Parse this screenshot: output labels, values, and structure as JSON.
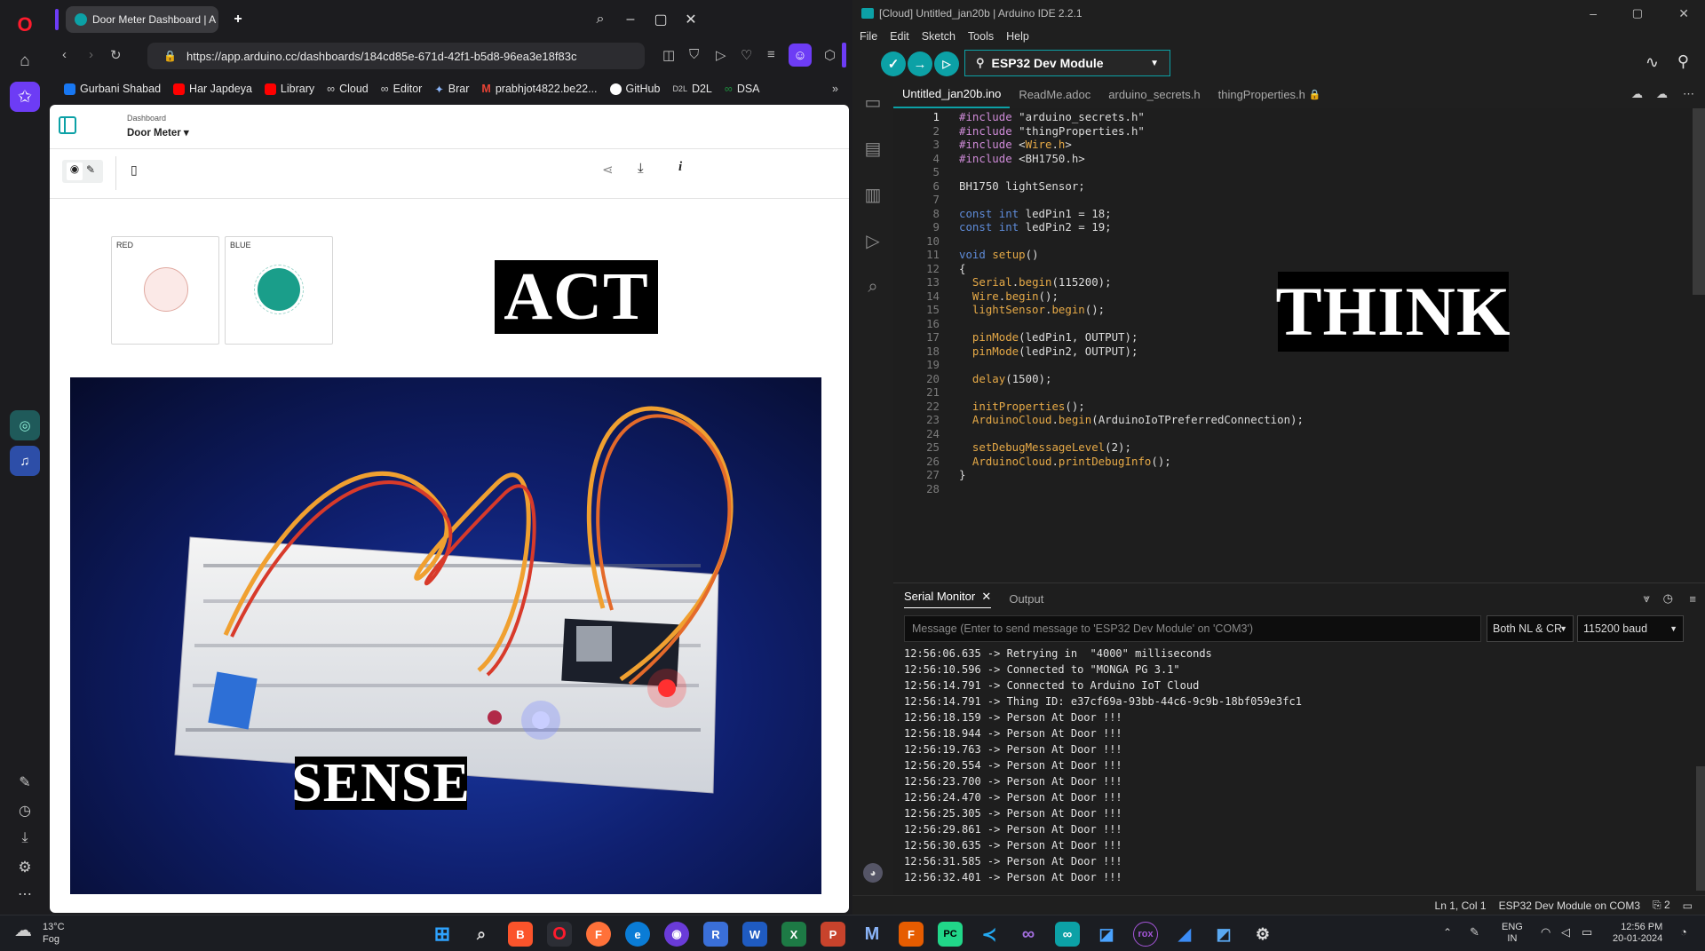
{
  "browser": {
    "tab_title": "Door Meter Dashboard | A",
    "url": "https://app.arduino.cc/dashboards/184cd85e-671d-42f1-b5d8-96ea3e18f83c",
    "bookmarks": [
      "Gurbani Shabad",
      "Har Japdeya",
      "Library",
      "Cloud",
      "Editor",
      "Brar",
      "prabhjot4822.be22...",
      "GitHub",
      "D2L",
      "DSA"
    ],
    "bookmark_colors": [
      "#1877f2",
      "#ff0000",
      "#ff0000",
      "#cccccc",
      "#cccccc",
      "#8ab4f8",
      "#ea4335",
      "#ffffff",
      "#cccccc",
      "#1e8e3e"
    ]
  },
  "dashboard": {
    "breadcrumb": "Dashboard",
    "name": "Door Meter",
    "widgets": [
      {
        "label": "RED",
        "state": "off",
        "color": "#fbe9e7"
      },
      {
        "label": "BLUE",
        "state": "on",
        "color": "#1a9e8a"
      }
    ]
  },
  "overlays": {
    "act": "ACT",
    "think": "THINK",
    "sense": "SENSE"
  },
  "ide": {
    "title": "[Cloud] Untitled_jan20b | Arduino IDE 2.2.1",
    "menu": [
      "File",
      "Edit",
      "Sketch",
      "Tools",
      "Help"
    ],
    "board": "ESP32 Dev Module",
    "file_tabs": [
      "Untitled_jan20b.ino",
      "ReadMe.adoc",
      "arduino_secrets.h",
      "thingProperties.h"
    ],
    "code_lines": [
      "#include \"arduino_secrets.h\"",
      "#include \"thingProperties.h\"",
      "#include <Wire.h>",
      "#include <BH1750.h>",
      "",
      "BH1750 lightSensor;",
      "",
      "const int ledPin1 = 18;",
      "const int ledPin2 = 19;",
      "",
      "void setup()",
      "{",
      "  Serial.begin(115200);",
      "  Wire.begin();",
      "  lightSensor.begin();",
      "",
      "  pinMode(ledPin1, OUTPUT);",
      "  pinMode(ledPin2, OUTPUT);",
      "",
      "  delay(1500);",
      "",
      "  initProperties();",
      "  ArduinoCloud.begin(ArduinoIoTPreferredConnection);",
      "",
      "  setDebugMessageLevel(2);",
      "  ArduinoCloud.printDebugInfo();",
      "}",
      ""
    ],
    "serial_tab": "Serial Monitor",
    "output_tab": "Output",
    "message_placeholder": "Message (Enter to send message to 'ESP32 Dev Module' on 'COM3')",
    "line_ending": "Both NL & CR",
    "baud": "115200 baud",
    "serial_log": [
      "12:56:06.635 -> Retrying in  \"4000\" milliseconds",
      "12:56:10.596 -> Connected to \"MONGA PG 3.1\"",
      "12:56:14.791 -> Connected to Arduino IoT Cloud",
      "12:56:14.791 -> Thing ID: e37cf69a-93bb-44c6-9c9b-18bf059e3fc1",
      "12:56:18.159 -> Person At Door !!!",
      "12:56:18.944 -> Person At Door !!!",
      "12:56:19.763 -> Person At Door !!!",
      "12:56:20.554 -> Person At Door !!!",
      "12:56:23.700 -> Person At Door !!!",
      "12:56:24.470 -> Person At Door !!!",
      "12:56:25.305 -> Person At Door !!!",
      "12:56:29.861 -> Person At Door !!!",
      "12:56:30.635 -> Person At Door !!!",
      "12:56:31.585 -> Person At Door !!!",
      "12:56:32.401 -> Person At Door !!!"
    ],
    "status_position": "Ln 1, Col 1",
    "status_board": "ESP32 Dev Module on COM3",
    "status_notifications": "2"
  },
  "taskbar": {
    "weather_temp": "13°C",
    "weather_desc": "Fog",
    "lang": "ENG",
    "region": "IN",
    "time": "12:56 PM",
    "date": "20-01-2024"
  }
}
